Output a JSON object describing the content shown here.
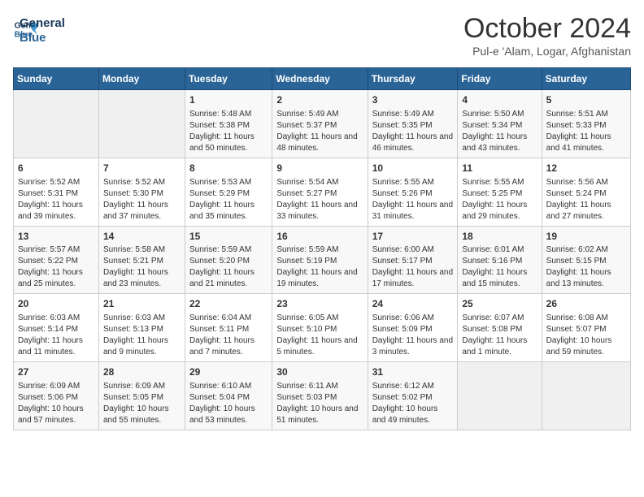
{
  "logo": {
    "line1": "General",
    "line2": "Blue"
  },
  "title": "October 2024",
  "location": "Pul-e 'Alam, Logar, Afghanistan",
  "days_of_week": [
    "Sunday",
    "Monday",
    "Tuesday",
    "Wednesday",
    "Thursday",
    "Friday",
    "Saturday"
  ],
  "weeks": [
    [
      {
        "day": "",
        "empty": true
      },
      {
        "day": "",
        "empty": true
      },
      {
        "day": "1",
        "sunrise": "Sunrise: 5:48 AM",
        "sunset": "Sunset: 5:38 PM",
        "daylight": "Daylight: 11 hours and 50 minutes."
      },
      {
        "day": "2",
        "sunrise": "Sunrise: 5:49 AM",
        "sunset": "Sunset: 5:37 PM",
        "daylight": "Daylight: 11 hours and 48 minutes."
      },
      {
        "day": "3",
        "sunrise": "Sunrise: 5:49 AM",
        "sunset": "Sunset: 5:35 PM",
        "daylight": "Daylight: 11 hours and 46 minutes."
      },
      {
        "day": "4",
        "sunrise": "Sunrise: 5:50 AM",
        "sunset": "Sunset: 5:34 PM",
        "daylight": "Daylight: 11 hours and 43 minutes."
      },
      {
        "day": "5",
        "sunrise": "Sunrise: 5:51 AM",
        "sunset": "Sunset: 5:33 PM",
        "daylight": "Daylight: 11 hours and 41 minutes."
      }
    ],
    [
      {
        "day": "6",
        "sunrise": "Sunrise: 5:52 AM",
        "sunset": "Sunset: 5:31 PM",
        "daylight": "Daylight: 11 hours and 39 minutes."
      },
      {
        "day": "7",
        "sunrise": "Sunrise: 5:52 AM",
        "sunset": "Sunset: 5:30 PM",
        "daylight": "Daylight: 11 hours and 37 minutes."
      },
      {
        "day": "8",
        "sunrise": "Sunrise: 5:53 AM",
        "sunset": "Sunset: 5:29 PM",
        "daylight": "Daylight: 11 hours and 35 minutes."
      },
      {
        "day": "9",
        "sunrise": "Sunrise: 5:54 AM",
        "sunset": "Sunset: 5:27 PM",
        "daylight": "Daylight: 11 hours and 33 minutes."
      },
      {
        "day": "10",
        "sunrise": "Sunrise: 5:55 AM",
        "sunset": "Sunset: 5:26 PM",
        "daylight": "Daylight: 11 hours and 31 minutes."
      },
      {
        "day": "11",
        "sunrise": "Sunrise: 5:55 AM",
        "sunset": "Sunset: 5:25 PM",
        "daylight": "Daylight: 11 hours and 29 minutes."
      },
      {
        "day": "12",
        "sunrise": "Sunrise: 5:56 AM",
        "sunset": "Sunset: 5:24 PM",
        "daylight": "Daylight: 11 hours and 27 minutes."
      }
    ],
    [
      {
        "day": "13",
        "sunrise": "Sunrise: 5:57 AM",
        "sunset": "Sunset: 5:22 PM",
        "daylight": "Daylight: 11 hours and 25 minutes."
      },
      {
        "day": "14",
        "sunrise": "Sunrise: 5:58 AM",
        "sunset": "Sunset: 5:21 PM",
        "daylight": "Daylight: 11 hours and 23 minutes."
      },
      {
        "day": "15",
        "sunrise": "Sunrise: 5:59 AM",
        "sunset": "Sunset: 5:20 PM",
        "daylight": "Daylight: 11 hours and 21 minutes."
      },
      {
        "day": "16",
        "sunrise": "Sunrise: 5:59 AM",
        "sunset": "Sunset: 5:19 PM",
        "daylight": "Daylight: 11 hours and 19 minutes."
      },
      {
        "day": "17",
        "sunrise": "Sunrise: 6:00 AM",
        "sunset": "Sunset: 5:17 PM",
        "daylight": "Daylight: 11 hours and 17 minutes."
      },
      {
        "day": "18",
        "sunrise": "Sunrise: 6:01 AM",
        "sunset": "Sunset: 5:16 PM",
        "daylight": "Daylight: 11 hours and 15 minutes."
      },
      {
        "day": "19",
        "sunrise": "Sunrise: 6:02 AM",
        "sunset": "Sunset: 5:15 PM",
        "daylight": "Daylight: 11 hours and 13 minutes."
      }
    ],
    [
      {
        "day": "20",
        "sunrise": "Sunrise: 6:03 AM",
        "sunset": "Sunset: 5:14 PM",
        "daylight": "Daylight: 11 hours and 11 minutes."
      },
      {
        "day": "21",
        "sunrise": "Sunrise: 6:03 AM",
        "sunset": "Sunset: 5:13 PM",
        "daylight": "Daylight: 11 hours and 9 minutes."
      },
      {
        "day": "22",
        "sunrise": "Sunrise: 6:04 AM",
        "sunset": "Sunset: 5:11 PM",
        "daylight": "Daylight: 11 hours and 7 minutes."
      },
      {
        "day": "23",
        "sunrise": "Sunrise: 6:05 AM",
        "sunset": "Sunset: 5:10 PM",
        "daylight": "Daylight: 11 hours and 5 minutes."
      },
      {
        "day": "24",
        "sunrise": "Sunrise: 6:06 AM",
        "sunset": "Sunset: 5:09 PM",
        "daylight": "Daylight: 11 hours and 3 minutes."
      },
      {
        "day": "25",
        "sunrise": "Sunrise: 6:07 AM",
        "sunset": "Sunset: 5:08 PM",
        "daylight": "Daylight: 11 hours and 1 minute."
      },
      {
        "day": "26",
        "sunrise": "Sunrise: 6:08 AM",
        "sunset": "Sunset: 5:07 PM",
        "daylight": "Daylight: 10 hours and 59 minutes."
      }
    ],
    [
      {
        "day": "27",
        "sunrise": "Sunrise: 6:09 AM",
        "sunset": "Sunset: 5:06 PM",
        "daylight": "Daylight: 10 hours and 57 minutes."
      },
      {
        "day": "28",
        "sunrise": "Sunrise: 6:09 AM",
        "sunset": "Sunset: 5:05 PM",
        "daylight": "Daylight: 10 hours and 55 minutes."
      },
      {
        "day": "29",
        "sunrise": "Sunrise: 6:10 AM",
        "sunset": "Sunset: 5:04 PM",
        "daylight": "Daylight: 10 hours and 53 minutes."
      },
      {
        "day": "30",
        "sunrise": "Sunrise: 6:11 AM",
        "sunset": "Sunset: 5:03 PM",
        "daylight": "Daylight: 10 hours and 51 minutes."
      },
      {
        "day": "31",
        "sunrise": "Sunrise: 6:12 AM",
        "sunset": "Sunset: 5:02 PM",
        "daylight": "Daylight: 10 hours and 49 minutes."
      },
      {
        "day": "",
        "empty": true
      },
      {
        "day": "",
        "empty": true
      }
    ]
  ]
}
